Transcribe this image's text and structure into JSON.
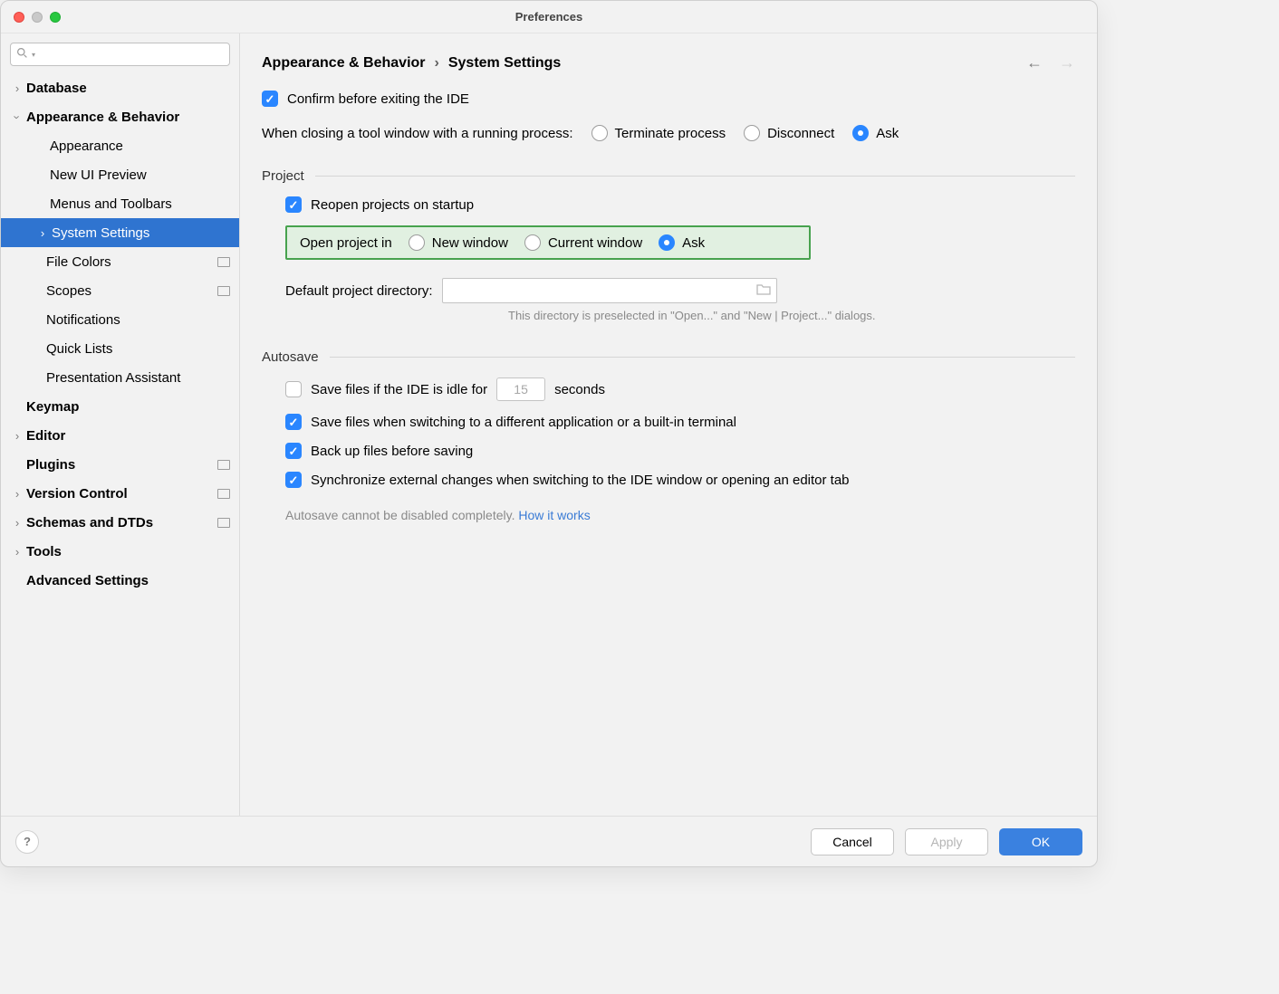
{
  "window_title": "Preferences",
  "sidebar": {
    "search_placeholder": "",
    "items": {
      "database": "Database",
      "appearance_behavior": "Appearance & Behavior",
      "appearance": "Appearance",
      "new_ui": "New UI Preview",
      "menus_toolbars": "Menus and Toolbars",
      "system_settings": "System Settings",
      "file_colors": "File Colors",
      "scopes": "Scopes",
      "notifications": "Notifications",
      "quick_lists": "Quick Lists",
      "presentation_assistant": "Presentation Assistant",
      "keymap": "Keymap",
      "editor": "Editor",
      "plugins": "Plugins",
      "version_control": "Version Control",
      "schemas_dtds": "Schemas and DTDs",
      "tools": "Tools",
      "advanced": "Advanced Settings"
    }
  },
  "breadcrumb": {
    "part1": "Appearance & Behavior",
    "sep": "›",
    "part2": "System Settings"
  },
  "general": {
    "confirm_exit": "Confirm before exiting the IDE",
    "close_tool_label": "When closing a tool window with a running process:",
    "terminate": "Terminate process",
    "disconnect": "Disconnect",
    "ask": "Ask"
  },
  "project": {
    "header": "Project",
    "reopen": "Reopen projects on startup",
    "open_in_label": "Open project in",
    "new_window": "New window",
    "current_window": "Current window",
    "ask": "Ask",
    "default_dir_label": "Default project directory:",
    "default_dir_value": "",
    "hint": "This directory is preselected in \"Open...\" and \"New | Project...\" dialogs."
  },
  "autosave": {
    "header": "Autosave",
    "idle_prefix": "Save files if the IDE is idle for",
    "idle_value": "15",
    "idle_suffix": "seconds",
    "switch_app": "Save files when switching to a different application or a built-in terminal",
    "backup": "Back up files before saving",
    "sync": "Synchronize external changes when switching to the IDE window or opening an editor tab",
    "note_prefix": "Autosave cannot be disabled completely. ",
    "note_link": "How it works"
  },
  "footer": {
    "cancel": "Cancel",
    "apply": "Apply",
    "ok": "OK"
  }
}
